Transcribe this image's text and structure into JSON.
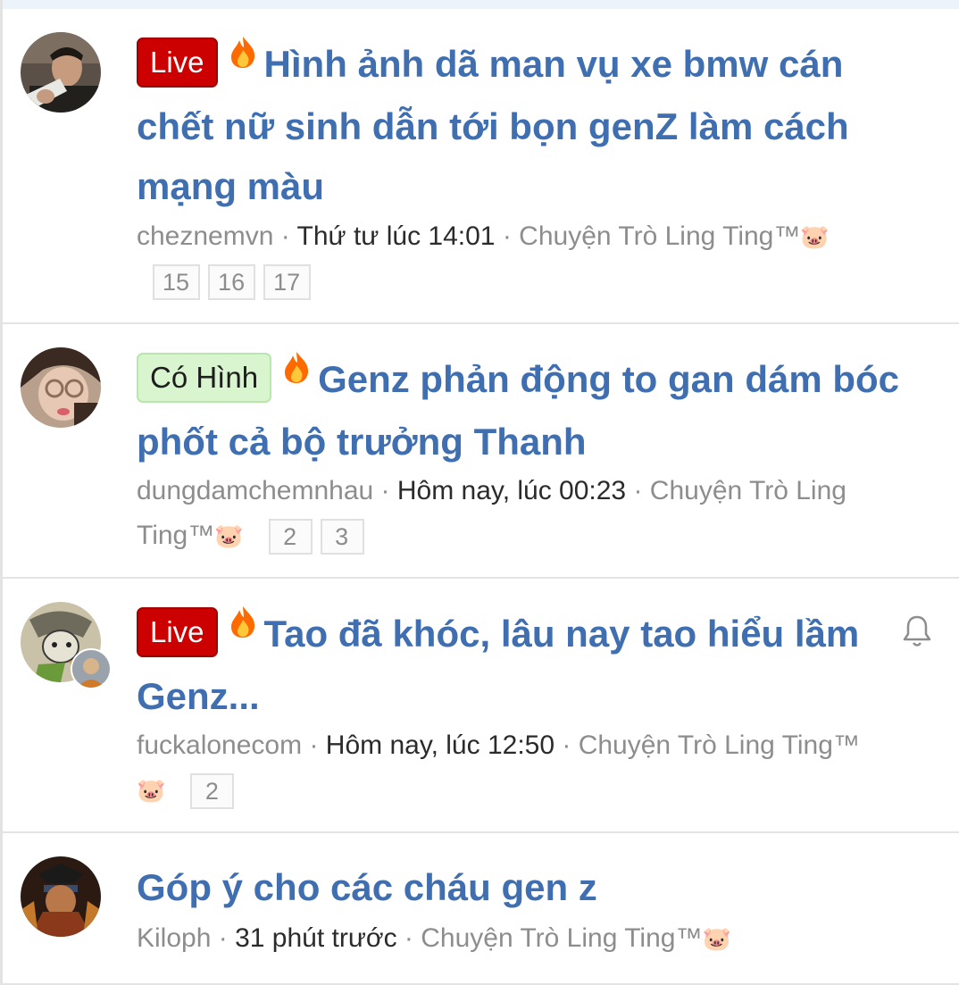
{
  "threads": [
    {
      "prefix": "Live",
      "title": "Hình ảnh dã man vụ xe bmw cán chết nữ sinh dẫn tới bọn genZ làm cách mạng màu",
      "author": "cheznemvn",
      "time": "Thứ tư lúc 14:01",
      "forum": "Chuyện Trò Ling Ting™",
      "forum_emoji": "🐷",
      "pages": [
        "15",
        "16",
        "17"
      ]
    },
    {
      "prefix": "Có Hình",
      "title": "Genz phản động to gan dám bóc phốt cả bộ trưởng Thanh",
      "author": "dungdamchemnhau",
      "time": "Hôm nay, lúc 00:23",
      "forum": "Chuyện Trò Ling Ting™",
      "forum_emoji": "🐷",
      "pages": [
        "2",
        "3"
      ]
    },
    {
      "prefix": "Live",
      "title": "Tao đã khóc, lâu nay tao hiểu lầm Genz...",
      "author": "fuckalonecom",
      "time": "Hôm nay, lúc 12:50",
      "forum": "Chuyện Trò Ling Ting™",
      "forum_emoji": "🐷",
      "pages": [
        "2"
      ],
      "watch_icon": "bell-icon"
    },
    {
      "title": "Góp ý cho các cháu gen z",
      "author": "Kiloph",
      "time": "31 phút trước",
      "forum": "Chuyện Trò Ling Ting™",
      "forum_emoji": "🐷"
    }
  ],
  "sep": " · ",
  "hot_icon": "fire-icon",
  "colors": {
    "title": "#3f6fb0",
    "live_badge": "#cc0000",
    "cohinh_badge": "#d9f5cf",
    "meta": "#8d8d8d"
  }
}
